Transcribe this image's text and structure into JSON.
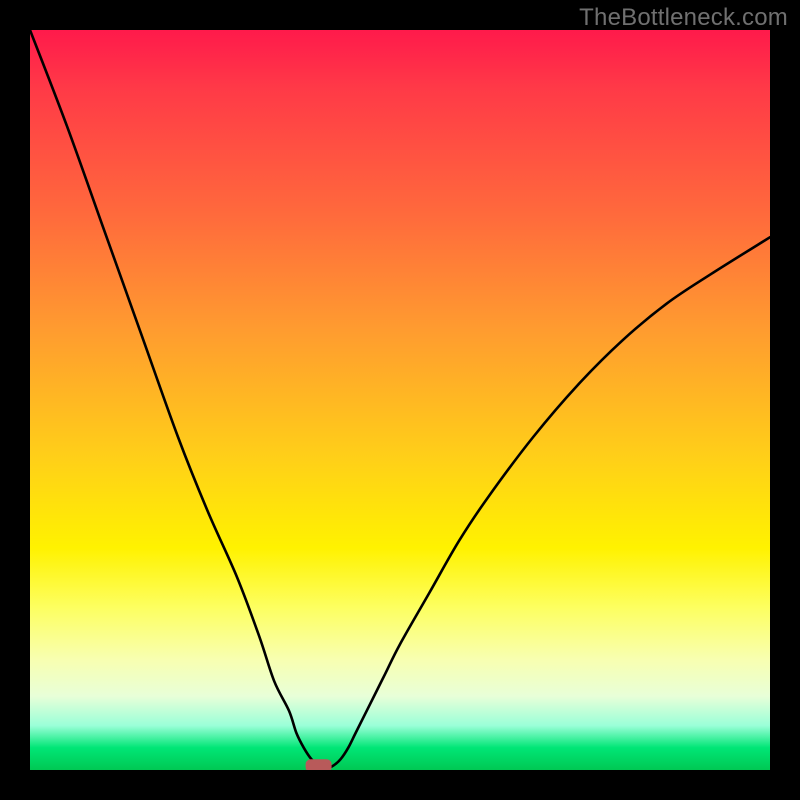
{
  "watermark": {
    "text": "TheBottleneck.com"
  },
  "chart_data": {
    "type": "line",
    "title": "",
    "xlabel": "",
    "ylabel": "",
    "xlim": [
      0,
      100
    ],
    "ylim": [
      0,
      100
    ],
    "x": [
      0,
      5,
      10,
      15,
      20,
      24,
      28,
      31,
      33,
      35,
      36,
      37,
      38,
      39,
      40,
      41,
      42,
      43,
      44,
      46,
      48,
      50,
      54,
      58,
      62,
      68,
      74,
      80,
      86,
      92,
      100
    ],
    "values": [
      100,
      87,
      73,
      59,
      45,
      35,
      26,
      18,
      12,
      8,
      5,
      3,
      1.5,
      0.6,
      0.2,
      0.6,
      1.5,
      3,
      5,
      9,
      13,
      17,
      24,
      31,
      37,
      45,
      52,
      58,
      63,
      67,
      72
    ],
    "series_notes": "V-shaped bottleneck curve; minimum near x≈40",
    "marker": {
      "x": 39,
      "y": 0.5,
      "color": "#b85a5a"
    },
    "colors": {
      "curve": "#000000",
      "marker": "#b85a5a",
      "gradient_top": "#ff1a4b",
      "gradient_mid": "#fff200",
      "gradient_bottom": "#00c853",
      "frame": "#000000"
    }
  }
}
